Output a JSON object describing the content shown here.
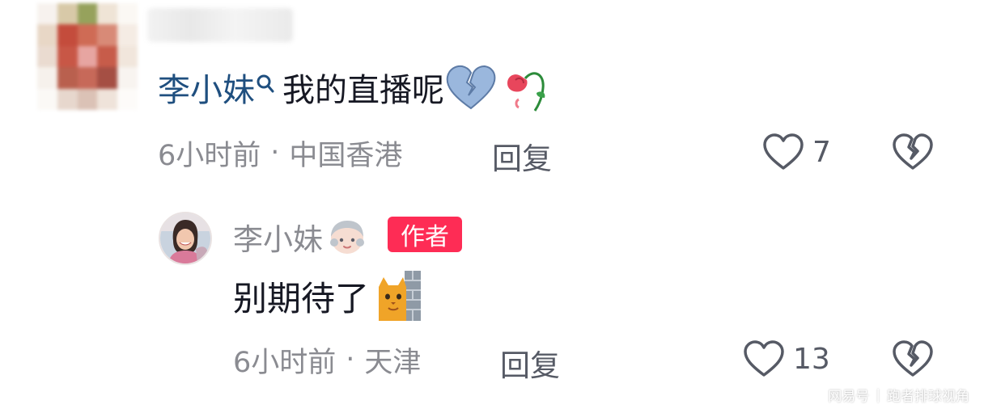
{
  "top_comment": {
    "mention": "李小妹",
    "text": "我的直播呢",
    "emojis": [
      "broken-heart",
      "wilted-rose"
    ],
    "time": "6小时前",
    "separator": "·",
    "location": "中国香港",
    "reply_label": "回复",
    "like_count": "7"
  },
  "reply": {
    "author_name": "李小妹",
    "badge": "作者",
    "text": "别期待了",
    "emoji": "cat-behind-wall",
    "time": "6小时前",
    "separator": "·",
    "location": "天津",
    "reply_label": "回复",
    "like_count": "13"
  },
  "watermark": {
    "source": "网易号",
    "separator": "|",
    "account": "跑者排球视角"
  },
  "colors": {
    "text_primary": "#161823",
    "text_secondary": "#8a8b91",
    "mention": "#1f4f7f",
    "badge_bg": "#fe2c55"
  }
}
